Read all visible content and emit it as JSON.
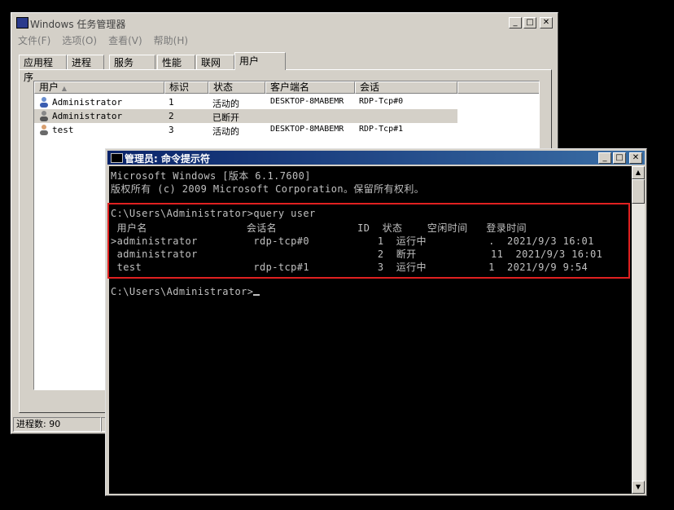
{
  "taskmgr": {
    "title": "Windows 任务管理器",
    "menu": [
      "文件(F)",
      "选项(O)",
      "查看(V)",
      "帮助(H)"
    ],
    "tabs": [
      "应用程序",
      "进程",
      "服务",
      "性能",
      "联网",
      "用户"
    ],
    "active_tab": "用户",
    "columns": [
      "用户",
      "标识",
      "状态",
      "客户端名",
      "会话"
    ],
    "rows": [
      {
        "user": "Administrator",
        "id": "1",
        "status": "活动的",
        "client": "DESKTOP-8MABEMR",
        "session": "RDP-Tcp#0"
      },
      {
        "user": "Administrator",
        "id": "2",
        "status": "已断开",
        "client": "",
        "session": ""
      },
      {
        "user": "test",
        "id": "3",
        "status": "活动的",
        "client": "DESKTOP-8MABEMR",
        "session": "RDP-Tcp#1"
      }
    ],
    "status_bar": {
      "processes": "进程数: 90",
      "second": ""
    }
  },
  "cmd": {
    "title": "管理员: 命令提示符",
    "lines": [
      "Microsoft Windows [版本 6.1.7600]",
      "版权所有 (c) 2009 Microsoft Corporation。保留所有权利。",
      "",
      "C:\\Users\\Administrator>query user",
      " 用户名                会话名             ID  状态    空闲时间   登录时间",
      ">administrator         rdp-tcp#0           1  运行中          .  2021/9/3 16:01",
      " administrator                             2  断开            11  2021/9/3 16:01",
      " test                  rdp-tcp#1           3  运行中          1  2021/9/9 9:54",
      "",
      "C:\\Users\\Administrator>"
    ]
  },
  "colors": {
    "cmd_title_start": "#0a246a",
    "cmd_title_end": "#3a6ea5",
    "highlight_box": "#e02020",
    "console_text": "#c0c0c0"
  }
}
